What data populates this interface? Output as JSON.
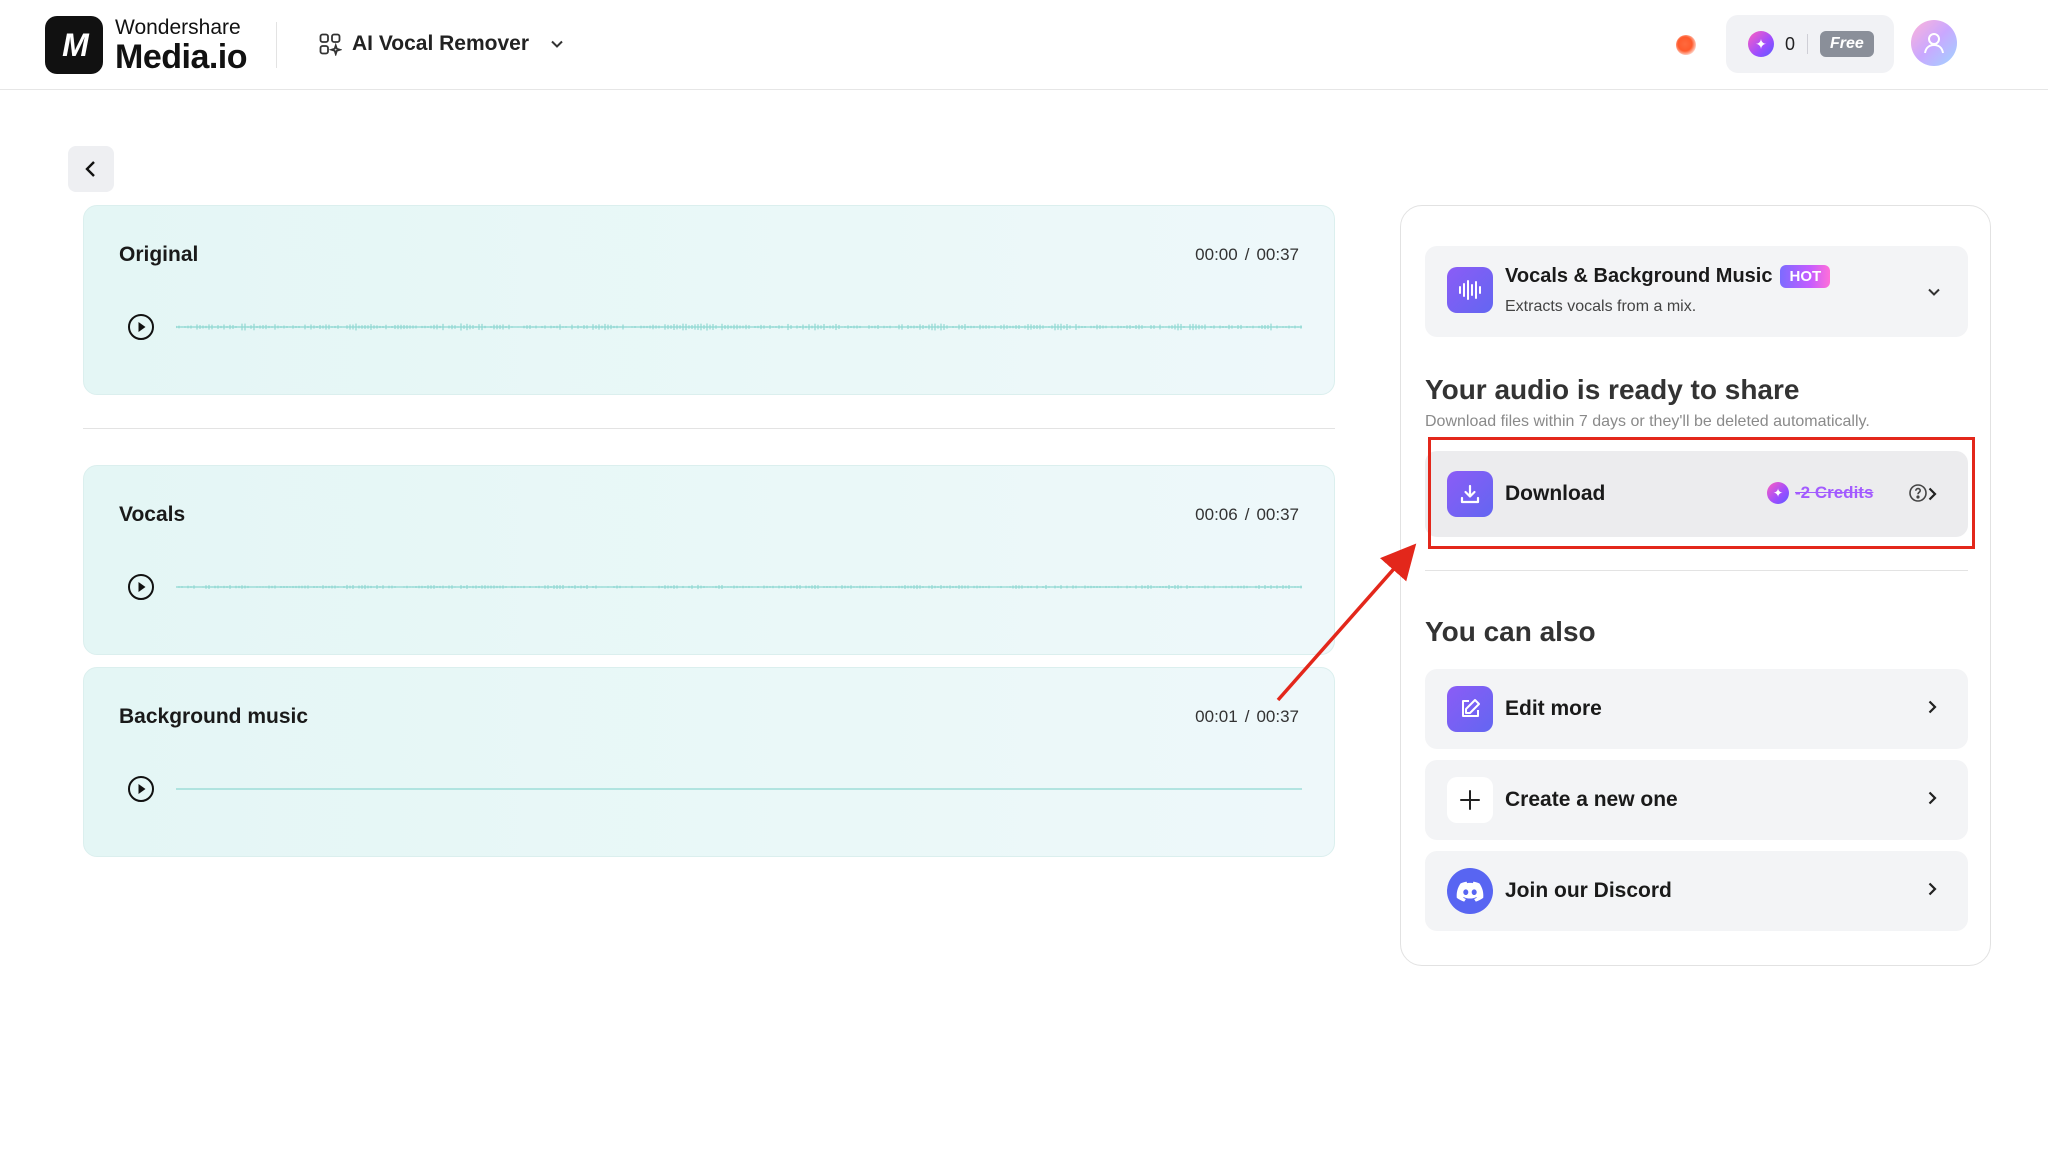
{
  "header": {
    "logo_top": "Wondershare",
    "logo_bottom": "Media.io",
    "tool_name": "AI Vocal Remover",
    "credits_count": "0",
    "plan_badge": "Free"
  },
  "tracks": [
    {
      "title": "Original",
      "current_time": "00:00",
      "separator": "/",
      "duration": "00:37"
    },
    {
      "title": "Vocals",
      "current_time": "00:06",
      "separator": "/",
      "duration": "00:37"
    },
    {
      "title": "Background music",
      "current_time": "00:01",
      "separator": "/",
      "duration": "00:37"
    }
  ],
  "panel": {
    "mode": {
      "title": "Vocals & Background Music",
      "badge": "HOT",
      "subtitle": "Extracts vocals from a mix."
    },
    "ready_title": "Your audio is ready to share",
    "ready_subtitle": "Download files within 7 days or they'll be deleted automatically.",
    "download": {
      "label": "Download",
      "credits": "-2 Credits"
    },
    "also_title": "You can also",
    "actions": [
      {
        "label": "Edit more",
        "icon": "edit-icon"
      },
      {
        "label": "Create a new one",
        "icon": "plus-icon"
      },
      {
        "label": "Join our Discord",
        "icon": "discord-icon"
      }
    ]
  },
  "colors": {
    "accent_purple": "#7c5cf6",
    "highlight_red": "#e3271b",
    "card_teal": "#e4f6f5",
    "waveform": "#8fd8d2"
  }
}
